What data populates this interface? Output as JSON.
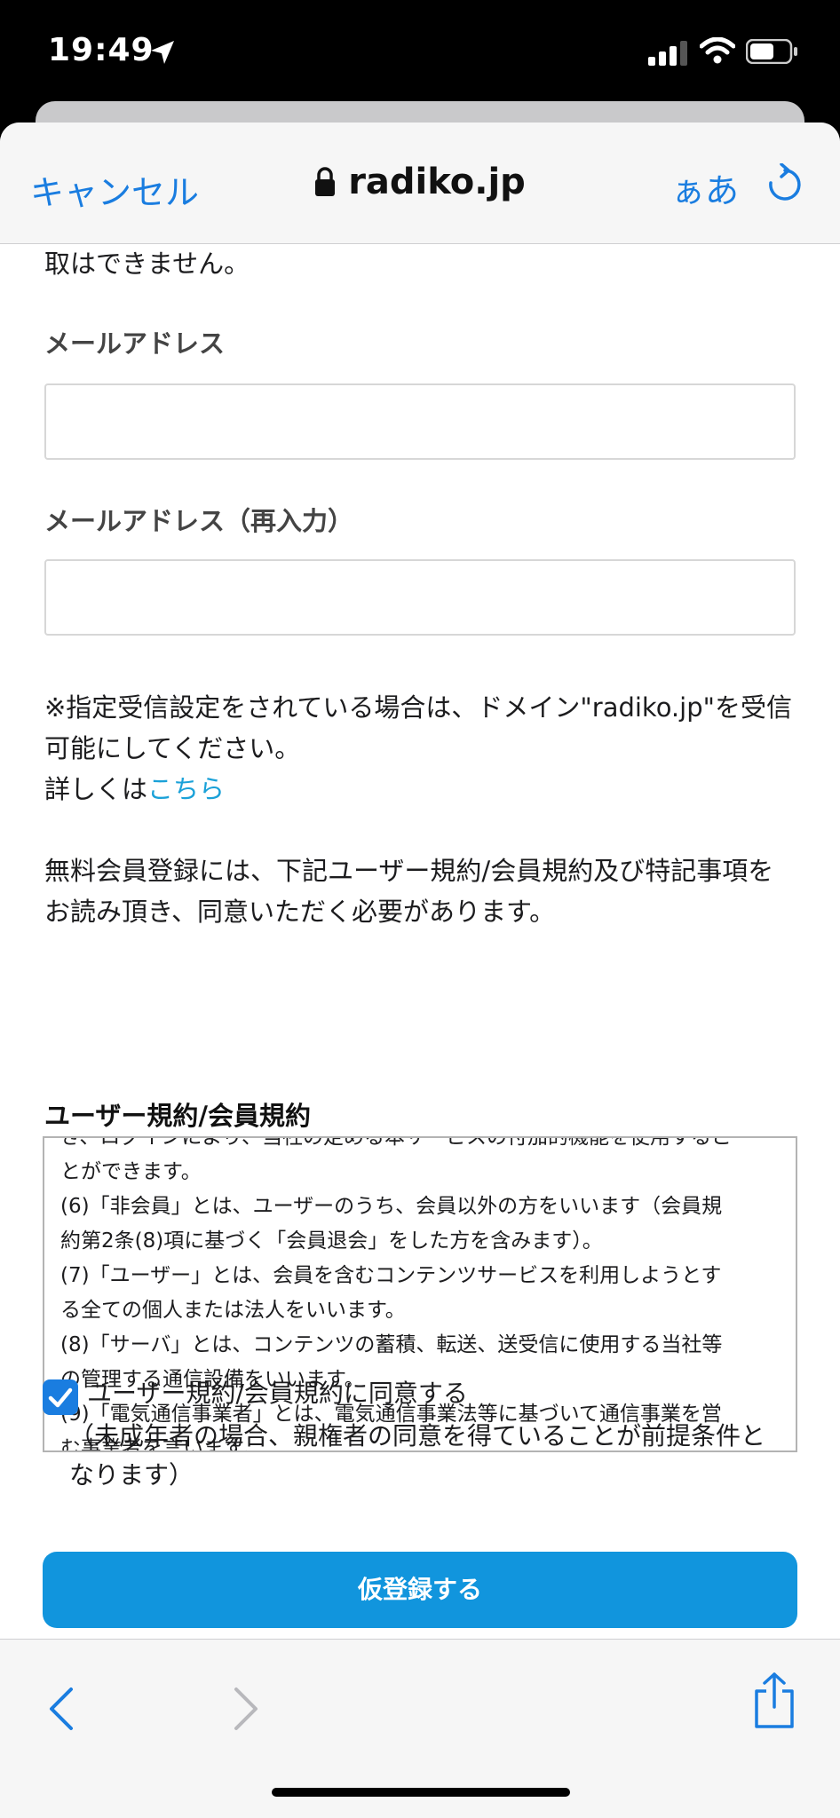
{
  "status_bar": {
    "time": "19:49",
    "icons": [
      "location-arrow-icon",
      "cellular-signal-icon",
      "wifi-icon",
      "battery-icon"
    ]
  },
  "nav": {
    "cancel_label": "キャンセル",
    "url": "radiko.jp",
    "text_size_label": "ぁあ",
    "icons": [
      "lock-icon",
      "reload-icon"
    ]
  },
  "form": {
    "partial_text": "取はできません。",
    "email_label": "メールアドレス",
    "email_value": "",
    "email_confirm_label": "メールアドレス（再入力）",
    "email_confirm_value": "",
    "notice_line1": "※指定受信設定をされている場合は、ドメイン\"radiko.jp\"を受信",
    "notice_line2": "可能にしてください。",
    "details_prefix": "詳しくは",
    "details_link": "こちら",
    "agreement_line1": "無料会員登録には、下記ユーザー規約/会員規約及び特記事項を",
    "agreement_line2": "お読み頂き、同意いただく必要があります。",
    "terms_heading": "ユーザー規約/会員規約",
    "terms_lines": [
      "き、ログインにより、当社の定める本サービスの付加的機能を使用するこ",
      "とができます。",
      "(6)「非会員」とは、ユーザーのうち、会員以外の方をいいます（会員規",
      "約第2条(8)項に基づく「会員退会」をした方を含みます）。",
      "(7)「ユーザー」とは、会員を含むコンテンツサービスを利用しようとす",
      "る全ての個人または法人をいいます。",
      "(8)「サーバ」とは、コンテンツの蓄積、転送、送受信に使用する当社等",
      "の管理する通信設備をいいます。",
      "(9)「電気通信事業者」とは、電気通信事業法等に基づいて通信事業を営",
      "む事業者を言います。"
    ],
    "agree_checked": true,
    "agree_label": "ユーザー規約/会員規約に同意する",
    "agree_note_line1": "（未成年者の場合、親権者の同意を得ていることが前提条件と",
    "agree_note_line2": "なります）",
    "submit_label": "仮登録する"
  },
  "toolbar": {
    "icons": [
      "back-chevron-icon",
      "forward-chevron-icon",
      "share-icon"
    ]
  },
  "colors": {
    "accent": "#1a7de0",
    "button": "#1195dd",
    "link": "#1aa1d8"
  }
}
